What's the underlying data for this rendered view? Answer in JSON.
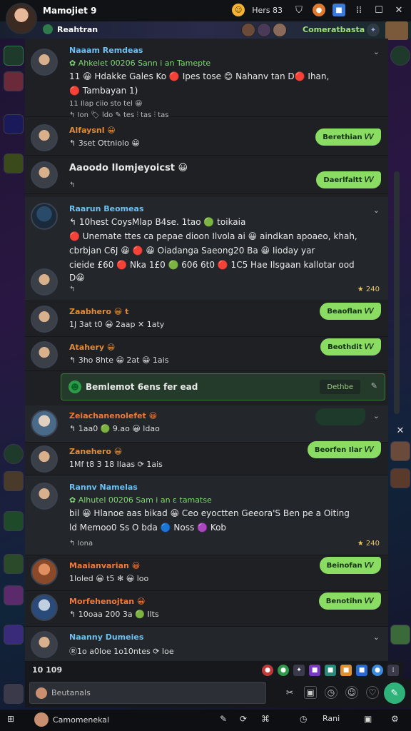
{
  "window": {
    "title": "Mamojiet 9",
    "mid_text": "Hers 83",
    "controls": [
      "emoji-icon",
      "shield-icon",
      "orange-icon",
      "blue-icon",
      "grid-icon",
      "maximize-icon",
      "close-icon"
    ]
  },
  "subheader": {
    "label": "Reahtran",
    "right_label": "Comeratbasta"
  },
  "messages": [
    {
      "name": "Naaam Remdeas",
      "lines": [
        "✿ Ahkelet 00206 Sann i an Tamepte",
        "11 😀 Hdakke Gales Ko 🔴 Ipes tose 😊 Nahanv tan D🔴 Ihan,",
        "🔴 Tambayan 1)",
        "11 Ilap ciio sto tel 😀"
      ],
      "meta": "↰  Ion   🏷  ldo  ✎  tes  ⫶  tas  ⫶  tas",
      "bubble": ""
    },
    {
      "name": "Alfaysnl 😀",
      "lines": [
        "↰ 3set Ottniolo 😀"
      ],
      "bubble": "Berethian 𝑉𝑉"
    },
    {
      "name": "",
      "lines": [
        "Aaoodo Ilomjeyoicst 😀"
      ],
      "meta": "↰",
      "bubble": "Daerlfaltt 𝑉𝑉"
    },
    {
      "name": "Raarun Beomeas",
      "lines": [
        "↰ 10hest CoysMlap B4se. 1tao 🟢 toikaia",
        "🔴 Unemate ttes ca pepae dioon Ilvola ai 😀 aindkan apoaeo, khah,",
        "cbrbjan C6J 😀 🔴 😀 Oiadanga Saeong20 Ba 😀 Iioday yar",
        "cieide £60 🔴 Nka 1£0 🟢 606 6t0 🔴 1C5 Hae Ilsgaan kallotar ood",
        "D😀"
      ],
      "meta": "↰",
      "count": "★ 240"
    },
    {
      "name": "Zaabhero 😀 t",
      "lines": [
        "1J 3at t0 😀 2aap ✕ 1aty"
      ],
      "bubble": "Beaoflan 𝑉𝑉"
    },
    {
      "name": "Atahery 😀",
      "lines": [
        "↰ 3ho 8hte 😀 2at 😀 1ais"
      ],
      "bubble": "Beothdit 𝑉𝑉"
    },
    {
      "name": "Zeiachanenolefet 😀",
      "lines": [
        "↰ 1aa0 🟢 9.ao 😀 ldao"
      ],
      "bubble": ""
    },
    {
      "name": "Zanehero 😀",
      "lines": [
        "1Mf t8 3 18 Ilaas ⟳ 1ais"
      ],
      "bubble": "Beorfen Ilar 𝑉𝑉"
    },
    {
      "name": "Rannv Namelas",
      "lines": [
        "✿ Alhutel 00206 Sam i an ε tamatse",
        "bil 😀 Hlanoe aas bikad 😀 Ceo eyoctten Geeora'S Ben pe a Oiting",
        "ld Memoo0 Ss O bda 🔵 Noss 🟣 Kob"
      ],
      "meta": "↰  Iona",
      "count": "★ 240"
    },
    {
      "name": "Maaianvarian 😀",
      "lines": [
        "1Ioled 😀 t5 ✻ 😀 loo"
      ],
      "bubble": "Beinofan 𝑉𝑉"
    },
    {
      "name": "Morfehenojtan 😀",
      "lines": [
        "↰ 10oaa 200 3a 🟢 Ilts"
      ],
      "bubble": "Benotihn 𝑉𝑉"
    },
    {
      "name": "Naanny Dumeies",
      "lines": [
        "Ⓡ1o a0Ioe 1o10ntes ⟳ Ioe"
      ],
      "bubble": ""
    }
  ],
  "system_banner": {
    "text": "Bemlemot 6ens fer ead",
    "button": "Dethbe"
  },
  "statusbar": {
    "left": "10  109"
  },
  "composer": {
    "placeholder": "Beutanals"
  },
  "bottomnav": {
    "label": "Camomenekal",
    "right_label": "Rani"
  },
  "colors": {
    "accent_green": "#8adc62",
    "name_orange": "#f08a3a",
    "name_blue": "#4aa8f0",
    "panel": "#1e2024"
  }
}
